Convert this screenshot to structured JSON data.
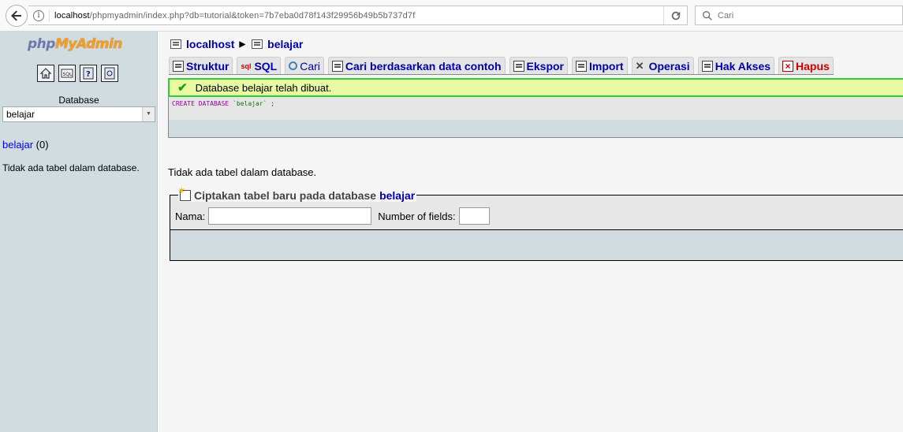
{
  "browser": {
    "url_host": "localhost",
    "url_path": "/phpmyadmin/index.php?db=tutorial&token=7b7eba0d78f143f29956b49b5b737d7f",
    "search_placeholder": "Cari"
  },
  "sidebar": {
    "logo_php": "php",
    "logo_myadmin": "MyAdmin",
    "database_label": "Database",
    "database_selected": "belajar",
    "db_link": "belajar",
    "db_count": "(0)",
    "no_tables": "Tidak ada tabel dalam database."
  },
  "breadcrumb": {
    "server": "localhost",
    "database": "belajar"
  },
  "tabs": [
    {
      "label": "Struktur",
      "icon": "structure-icon"
    },
    {
      "label": "SQL",
      "icon": "sql-icon"
    },
    {
      "label": "Cari",
      "icon": "search-icon"
    },
    {
      "label": "Cari berdasarkan data contoh",
      "icon": "query-icon"
    },
    {
      "label": "Ekspor",
      "icon": "export-icon"
    },
    {
      "label": "Import",
      "icon": "import-icon"
    },
    {
      "label": "Operasi",
      "icon": "operations-icon"
    },
    {
      "label": "Hak Akses",
      "icon": "privileges-icon"
    },
    {
      "label": "Hapus",
      "icon": "drop-icon"
    }
  ],
  "message": {
    "success": "Database belajar telah dibuat.",
    "sql_kw1": "CREATE DATABASE",
    "sql_str": "`belajar`",
    "sql_end": ";"
  },
  "main": {
    "no_tables": "Tidak ada tabel dalam database.",
    "create_legend": "Ciptakan tabel baru pada database",
    "create_db": "belajar",
    "name_label": "Nama:",
    "fields_label": "Number of fields:"
  },
  "colors": {
    "sidebar_bg": "#d0dce0",
    "link": "#0000aa",
    "success_border": "#2fcf2f",
    "danger": "#cc0000"
  }
}
